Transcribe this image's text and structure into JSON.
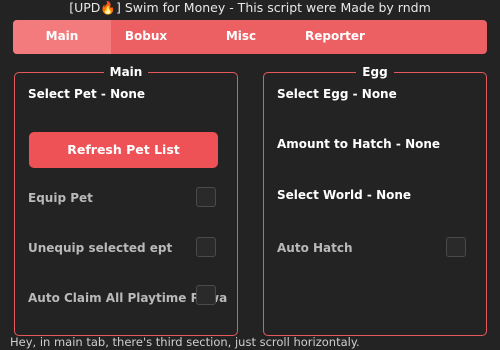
{
  "window": {
    "title": "[UPD🔥] Swim for Money - This script were Made by rndm"
  },
  "tabs": [
    {
      "label": "Main"
    },
    {
      "label": "Bobux"
    },
    {
      "label": "Misc"
    },
    {
      "label": "Reporter"
    }
  ],
  "main_panel": {
    "title": "Main",
    "select_pet": "Select Pet - None",
    "refresh_button": "Refresh Pet List",
    "equip_pet": "Equip Pet",
    "unequip_pet": "Unequip selected ept",
    "auto_claim": "Auto Claim All Playtime Rewards"
  },
  "egg_panel": {
    "title": "Egg",
    "select_egg": "Select Egg - None",
    "amount_to_hatch": "Amount to Hatch - None",
    "select_world": "Select World - None",
    "auto_hatch": "Auto Hatch"
  },
  "footer": {
    "hint": "Hey, in main tab, there's third section, just scroll horizontaly."
  },
  "colors": {
    "accent": "#ec5f63",
    "background": "#232323"
  }
}
